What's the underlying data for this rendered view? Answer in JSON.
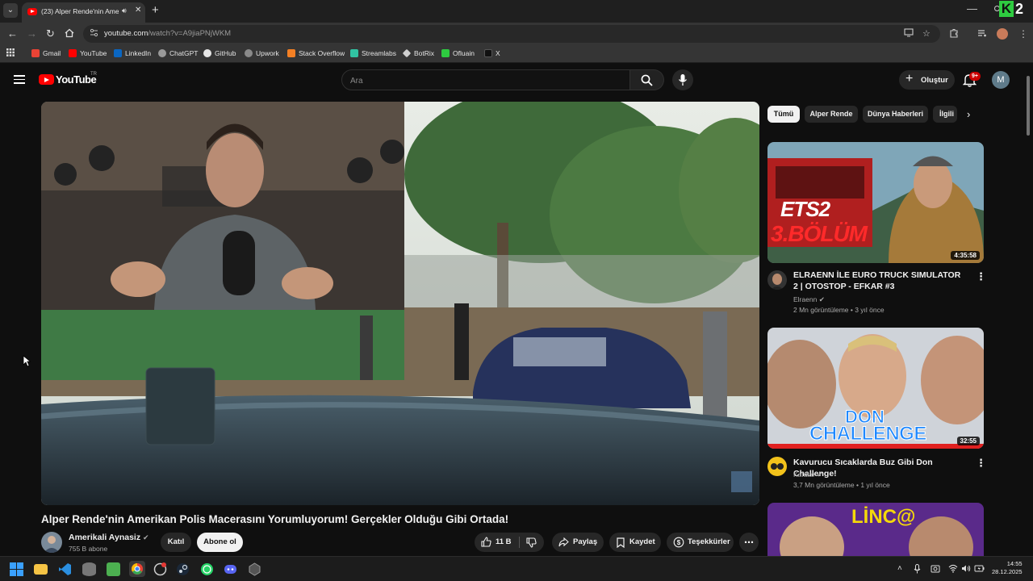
{
  "browser": {
    "tab_title": "(23) Alper Rende'nin Ameri",
    "url_host": "youtube.com",
    "url_path": "/watch?v=A9jiaPNjWKM",
    "bookmarks": [
      "Gmail",
      "YouTube",
      "LinkedIn",
      "ChatGPT",
      "GitHub",
      "Upwork",
      "Stack Overflow",
      "Streamlabs",
      "BotRix",
      "Ofluain",
      "X"
    ],
    "bookmark_colors": [
      "#ea4335",
      "#ff0000",
      "#0a66c2",
      "#9a9a9a",
      "#e6e6e6",
      "#8a8a8a",
      "#f48024",
      "#31c3a2",
      "#1a1a1a",
      "#2ecc40",
      "#111111"
    ]
  },
  "youtube": {
    "logo_text": "YouTube",
    "logo_region": "TR",
    "search_placeholder": "Ara",
    "create_label": "Oluştur",
    "notif_badge": "9+",
    "avatar_letter": "M"
  },
  "video": {
    "title": "Alper Rende'nin Amerikan Polis Macerasını Yorumluyorum! Gerçekler Olduğu Gibi Ortada!",
    "channel_name": "Amerikali Aynasiz",
    "subscribers": "755 B abone",
    "join_label": "Katıl",
    "subscribe_label": "Abone ol",
    "likes": "11 B",
    "share_label": "Paylaş",
    "save_label": "Kaydet",
    "thanks_label": "Teşekkürler"
  },
  "chips": [
    "Tümü",
    "Alper Rende",
    "Dünya Haberleri",
    "İlgili"
  ],
  "recommendations": [
    {
      "title": "ELRAENN İLE EURO TRUCK SIMULATOR 2 | OTOSTOP - EFKAR #3",
      "channel": "Elraenn",
      "views": "2 Mn görüntüleme",
      "age": "3 yıl önce",
      "duration": "4:35:58",
      "thumb_text_1": "ETS2",
      "thumb_text_2": "3.BÖLÜM"
    },
    {
      "title": "Kavurucu Sıcaklarda Buz Gibi Don Challenge!",
      "channel": "Kafalar",
      "views": "3,7 Mn görüntüleme",
      "age": "1 yıl önce",
      "duration": "32:55",
      "thumb_text_1": "DON",
      "thumb_text_2": "CHALLENGE"
    },
    {
      "thumb_text_1": "LİNC@"
    }
  ],
  "taskbar": {
    "time": "14:55",
    "date": "28.12.2025"
  }
}
